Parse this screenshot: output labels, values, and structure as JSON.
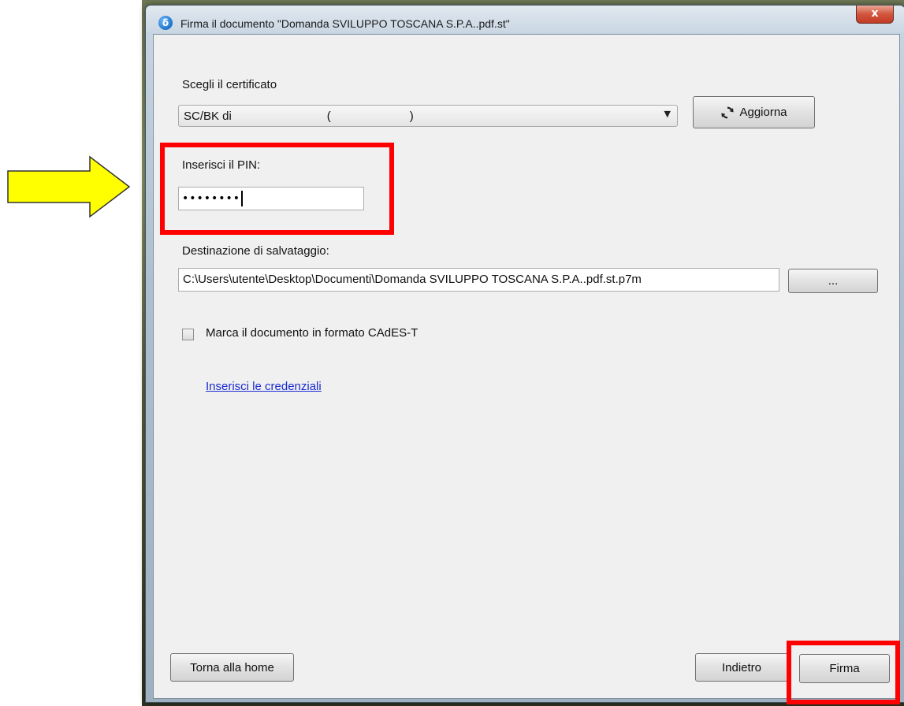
{
  "window": {
    "title": "Firma il documento \"Domanda SVILUPPO TOSCANA S.P.A..pdf.st\"",
    "app_icon": "δ",
    "close_label": "x"
  },
  "certificate": {
    "label": "Scegli il certificato",
    "selected_value": "SC/BK di                             (                        )",
    "refresh_label": "Aggiorna"
  },
  "pin": {
    "label": "Inserisci il PIN:",
    "masked_value": "••••••••"
  },
  "destination": {
    "label": "Destinazione di salvataggio:",
    "path_value": "C:\\Users\\utente\\Desktop\\Documenti\\Domanda SVILUPPO TOSCANA S.P.A..pdf.st.p7m",
    "browse_label": "..."
  },
  "timestamp_option": {
    "label": "Marca il documento in formato CAdES-T",
    "checked": false
  },
  "credentials_link": "Inserisci le credenziali",
  "footer": {
    "home_label": "Torna alla home",
    "back_label": "Indietro",
    "sign_label": "Firma"
  },
  "colors": {
    "highlight": "#ff0000",
    "arrow_fill": "#ffff00",
    "link": "#1a2bd0"
  },
  "icons": [
    "app-logo-icon",
    "refresh-icon",
    "dropdown-arrow-icon",
    "close-icon",
    "arrow-annotation-icon"
  ]
}
